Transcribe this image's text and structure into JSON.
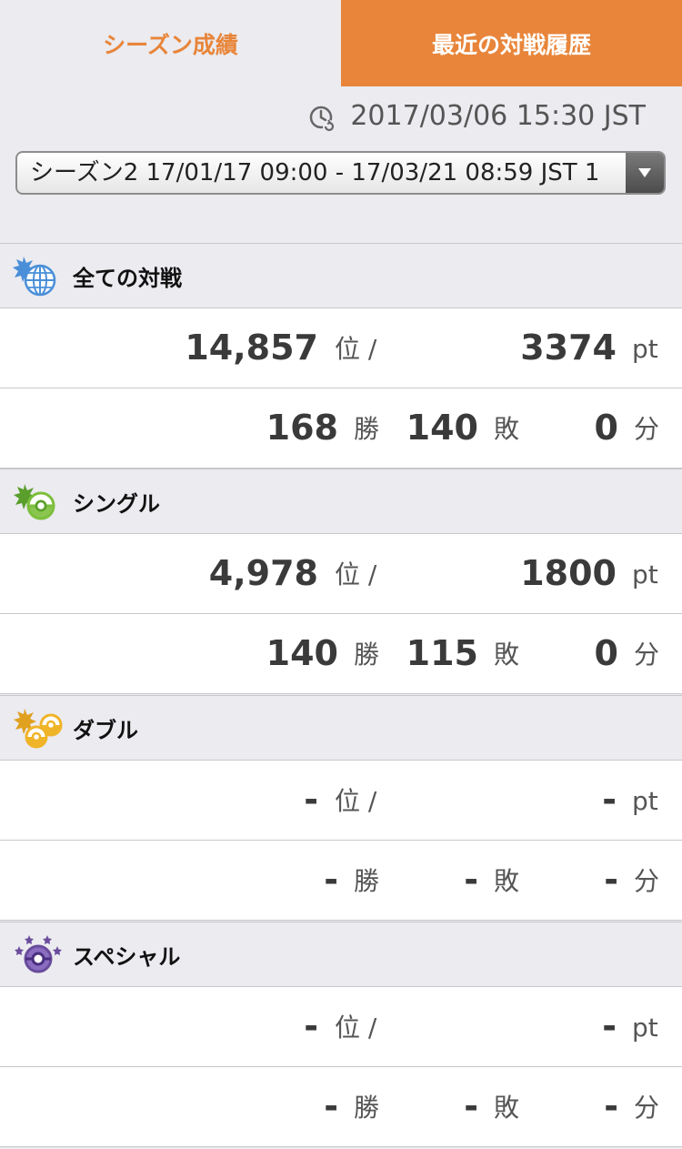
{
  "tabs": {
    "season_label": "シーズン成績",
    "recent_label": "最近の対戦履歴"
  },
  "timestamp": "2017/03/06 15:30 JST",
  "season_select": {
    "selected": "シーズン2 17/01/17 09:00 - 17/03/21 08:59 JST 1"
  },
  "units": {
    "rank": "位 /",
    "points": "pt",
    "win": "勝",
    "lose": "敗",
    "draw": "分"
  },
  "sections": [
    {
      "title": "全ての対戦",
      "icon": "globe-battle-icon",
      "rank": "14,857",
      "points": "3374",
      "wins": "168",
      "losses": "140",
      "draws": "0"
    },
    {
      "title": "シングル",
      "icon": "single-battle-icon",
      "rank": "4,978",
      "points": "1800",
      "wins": "140",
      "losses": "115",
      "draws": "0"
    },
    {
      "title": "ダブル",
      "icon": "double-battle-icon",
      "rank": "-",
      "points": "-",
      "wins": "-",
      "losses": "-",
      "draws": "-"
    },
    {
      "title": "スペシャル",
      "icon": "special-battle-icon",
      "rank": "-",
      "points": "-",
      "wins": "-",
      "losses": "-",
      "draws": "-"
    }
  ],
  "colors": {
    "accent": "#e8853a",
    "background": "#ebebf0",
    "single_green": "#7cbf3c",
    "double_yellow": "#f0b429",
    "special_purple": "#6a4c9c",
    "globe_blue": "#4a8fd8"
  }
}
